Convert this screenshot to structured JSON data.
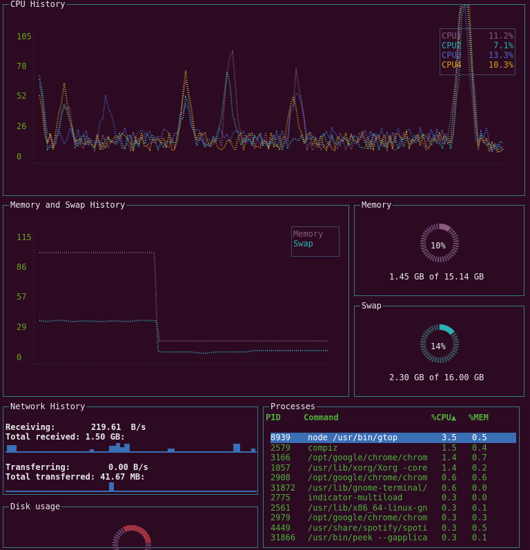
{
  "cpu_panel": {
    "title": "CPU History",
    "y_ticks": [
      "105",
      "78",
      "52",
      "26",
      "0"
    ],
    "legend": [
      {
        "label": "CPU1",
        "value": "11.2%",
        "color": "#8d5a7d"
      },
      {
        "label": "CPU2",
        "value": "7.1%",
        "color": "#2ab1b5"
      },
      {
        "label": "CPU3",
        "value": "13.3%",
        "color": "#4a6bc4"
      },
      {
        "label": "CPU4",
        "value": "10.3%",
        "color": "#d6a11b"
      }
    ]
  },
  "mem_swap_panel": {
    "title": "Memory and Swap History",
    "y_ticks": [
      "115",
      "86",
      "57",
      "29",
      "0"
    ],
    "legend": [
      {
        "label": "Memory",
        "color": "#8d5a7d"
      },
      {
        "label": "Swap",
        "color": "#2ab1b5"
      }
    ]
  },
  "memory_panel": {
    "title": "Memory",
    "percent": "10%",
    "summary": "1.45 GB of 15.14 GB",
    "fraction": 0.1
  },
  "swap_panel": {
    "title": "Swap",
    "percent": "14%",
    "summary": "2.30 GB of 16.00 GB",
    "fraction": 0.14
  },
  "network_panel": {
    "title": "Network History",
    "receiving_label": "Receiving:",
    "receiving_value": "219.61  B/s",
    "total_received": "Total received: 1.50 GB:",
    "transferring_label": "Transferring:",
    "transferring_value": "0.00 B/s",
    "total_transferred": "Total transferred: 41.67 MB:"
  },
  "disk_panel": {
    "title": "Disk usage"
  },
  "processes_panel": {
    "title": "Processes",
    "headers": {
      "pid": "PID",
      "command": "Command",
      "cpu": "%CPU▲",
      "mem": "%MEM"
    },
    "rows": [
      {
        "pid": "8939",
        "command": "node /usr/bin/gtop",
        "cpu": "3.5",
        "mem": "0.5"
      },
      {
        "pid": "2579",
        "command": "compiz",
        "cpu": "1.5",
        "mem": "0.4"
      },
      {
        "pid": "3166",
        "command": "/opt/google/chrome/chrom",
        "cpu": "1.4",
        "mem": "0.7"
      },
      {
        "pid": "1057",
        "command": "/usr/lib/xorg/Xorg -core",
        "cpu": "1.4",
        "mem": "0.2"
      },
      {
        "pid": "2908",
        "command": "/opt/google/chrome/chrom",
        "cpu": "0.6",
        "mem": "0.6"
      },
      {
        "pid": "31872",
        "command": "/usr/lib/gnome-terminal/",
        "cpu": "0.6",
        "mem": "0.0"
      },
      {
        "pid": "2775",
        "command": "indicator-multiload",
        "cpu": "0.3",
        "mem": "0.0"
      },
      {
        "pid": "2561",
        "command": "/usr/lib/x86_64-linux-gn",
        "cpu": "0.3",
        "mem": "0.1"
      },
      {
        "pid": "2979",
        "command": "/opt/google/chrome/chrom",
        "cpu": "0.3",
        "mem": "0.3"
      },
      {
        "pid": "4449",
        "command": "/usr/share/spotify/spoti",
        "cpu": "0.3",
        "mem": "0.5"
      },
      {
        "pid": "31866",
        "command": "/usr/bin/peek --gapplica",
        "cpu": "0.3",
        "mem": "0.1"
      }
    ]
  },
  "colors": {
    "background": "#2c0a22",
    "border": "#2f7f86",
    "axis": "#6aa31f",
    "selection": "#3a6fb5",
    "process_text": "#4fae3a",
    "spark": "#3a6fb5",
    "disk": "#d03030"
  }
}
